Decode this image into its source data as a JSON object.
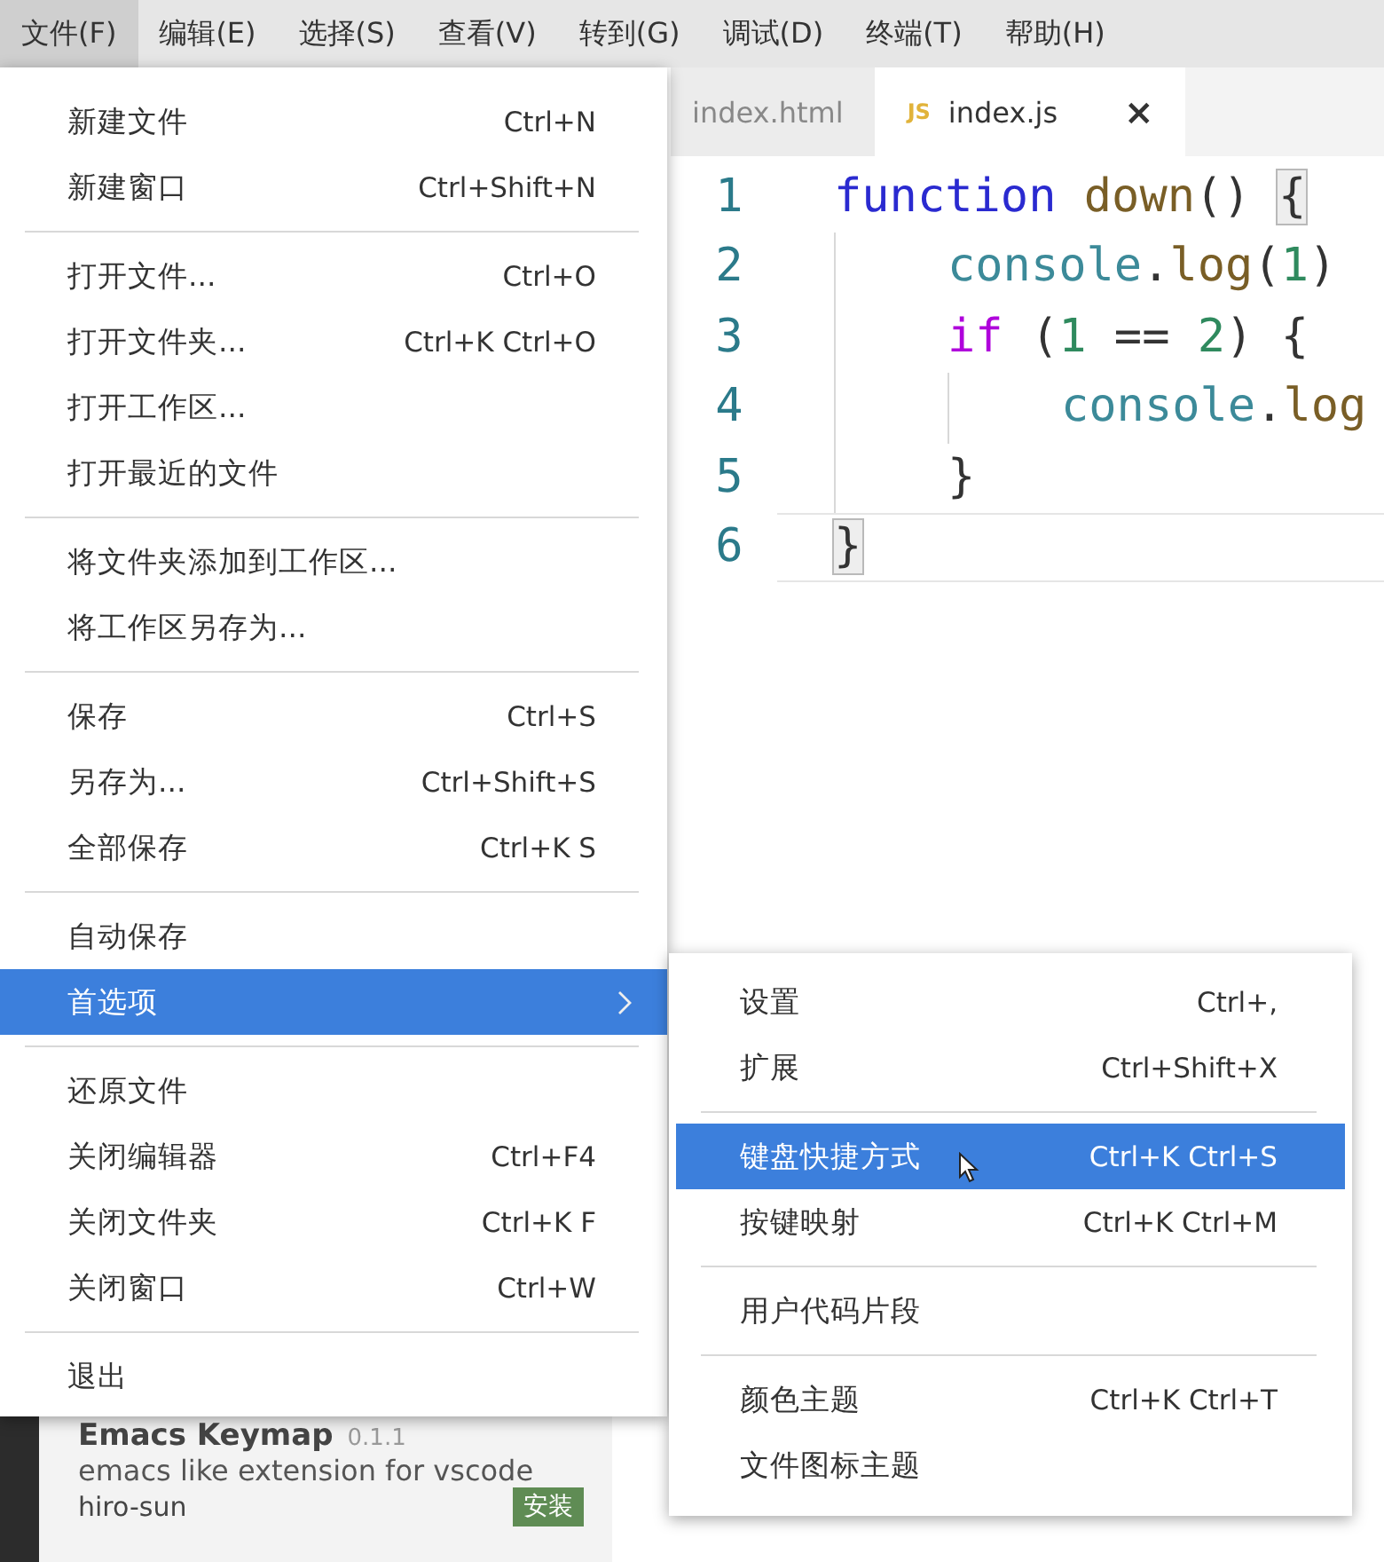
{
  "menu_bar": [
    {
      "label": "文件(F)",
      "selected": true
    },
    {
      "label": "编辑(E)",
      "selected": false
    },
    {
      "label": "选择(S)",
      "selected": false
    },
    {
      "label": "查看(V)",
      "selected": false
    },
    {
      "label": "转到(G)",
      "selected": false
    },
    {
      "label": "调试(D)",
      "selected": false
    },
    {
      "label": "终端(T)",
      "selected": false
    },
    {
      "label": "帮助(H)",
      "selected": false
    }
  ],
  "tabs": [
    {
      "label": "index.html",
      "selected": false
    },
    {
      "label": "index.js",
      "badge": "JS",
      "close": "×",
      "selected": true
    }
  ],
  "editor": {
    "lines": [
      {
        "number": "1",
        "active": false,
        "tokens": [
          {
            "text": "function ",
            "kind": "keyword"
          },
          {
            "text": "down",
            "kind": "func"
          },
          {
            "text": "() ",
            "kind": "punct"
          },
          {
            "text": "{",
            "kind": "bracket_match"
          }
        ],
        "children": [
          {
            "number": "2",
            "active": false,
            "tokens": [
              {
                "text": "console",
                "kind": "var"
              },
              {
                "text": ".",
                "kind": "punct"
              },
              {
                "text": "log",
                "kind": "func"
              },
              {
                "text": "(",
                "kind": "punct"
              },
              {
                "text": "1",
                "kind": "number"
              },
              {
                "text": ")",
                "kind": "punct"
              }
            ]
          },
          {
            "number": "3",
            "active": false,
            "tokens": [
              {
                "text": "if",
                "kind": "control"
              },
              {
                "text": " (",
                "kind": "punct"
              },
              {
                "text": "1",
                "kind": "number"
              },
              {
                "text": " == ",
                "kind": "punct"
              },
              {
                "text": "2",
                "kind": "number"
              },
              {
                "text": ") {",
                "kind": "punct"
              }
            ],
            "children": [
              {
                "number": "4",
                "active": false,
                "tokens": [
                  {
                    "text": "console",
                    "kind": "var"
                  },
                  {
                    "text": ".",
                    "kind": "punct"
                  },
                  {
                    "text": "log",
                    "kind": "func"
                  }
                ]
              }
            ]
          },
          {
            "number": "5",
            "active": false,
            "tokens": [
              {
                "text": "}",
                "kind": "punct"
              }
            ]
          }
        ]
      },
      {
        "number": "6",
        "active": true,
        "tokens": [
          {
            "text": "}",
            "kind": "bracket_match"
          }
        ]
      }
    ]
  },
  "extension": {
    "name": "Emacs Keymap",
    "version": "0.1.1",
    "description": "emacs like extension for vscode",
    "author": "hiro-sun",
    "install_button": "安装"
  },
  "file_menu": [
    {
      "kind": "item",
      "label": "新建文件",
      "shortcut": "Ctrl+N",
      "selected": false
    },
    {
      "kind": "item",
      "label": "新建窗口",
      "shortcut": "Ctrl+Shift+N",
      "selected": false
    },
    {
      "kind": "separator"
    },
    {
      "kind": "item",
      "label": "打开文件...",
      "shortcut": "Ctrl+O",
      "selected": false
    },
    {
      "kind": "item",
      "label": "打开文件夹...",
      "shortcut": "Ctrl+K Ctrl+O",
      "selected": false
    },
    {
      "kind": "item",
      "label": "打开工作区...",
      "selected": false
    },
    {
      "kind": "item",
      "label": "打开最近的文件",
      "selected": false
    },
    {
      "kind": "separator"
    },
    {
      "kind": "item",
      "label": "将文件夹添加到工作区...",
      "selected": false
    },
    {
      "kind": "item",
      "label": "将工作区另存为...",
      "selected": false
    },
    {
      "kind": "separator"
    },
    {
      "kind": "item",
      "label": "保存",
      "shortcut": "Ctrl+S",
      "selected": false
    },
    {
      "kind": "item",
      "label": "另存为...",
      "shortcut": "Ctrl+Shift+S",
      "selected": false
    },
    {
      "kind": "item",
      "label": "全部保存",
      "shortcut": "Ctrl+K S",
      "selected": false
    },
    {
      "kind": "separator"
    },
    {
      "kind": "item",
      "label": "自动保存",
      "selected": false
    },
    {
      "kind": "item",
      "label": "首选项",
      "submenu": true,
      "selected": true
    },
    {
      "kind": "separator"
    },
    {
      "kind": "item",
      "label": "还原文件",
      "selected": false
    },
    {
      "kind": "item",
      "label": "关闭编辑器",
      "shortcut": "Ctrl+F4",
      "selected": false
    },
    {
      "kind": "item",
      "label": "关闭文件夹",
      "shortcut": "Ctrl+K F",
      "selected": false
    },
    {
      "kind": "item",
      "label": "关闭窗口",
      "shortcut": "Ctrl+W",
      "selected": false
    },
    {
      "kind": "separator"
    },
    {
      "kind": "item",
      "label": "退出",
      "selected": false
    }
  ],
  "preferences_submenu": [
    {
      "kind": "item",
      "label": "设置",
      "shortcut": "Ctrl+,",
      "selected": false
    },
    {
      "kind": "item",
      "label": "扩展",
      "shortcut": "Ctrl+Shift+X",
      "selected": false
    },
    {
      "kind": "separator"
    },
    {
      "kind": "item",
      "label": "键盘快捷方式",
      "shortcut": "Ctrl+K Ctrl+S",
      "selected": true
    },
    {
      "kind": "item",
      "label": "按键映射",
      "shortcut": "Ctrl+K Ctrl+M",
      "selected": false
    },
    {
      "kind": "separator"
    },
    {
      "kind": "item",
      "label": "用户代码片段",
      "selected": false
    },
    {
      "kind": "separator"
    },
    {
      "kind": "item",
      "label": "颜色主题",
      "shortcut": "Ctrl+K Ctrl+T",
      "selected": false
    },
    {
      "kind": "item",
      "label": "文件图标主题",
      "selected": false
    }
  ]
}
